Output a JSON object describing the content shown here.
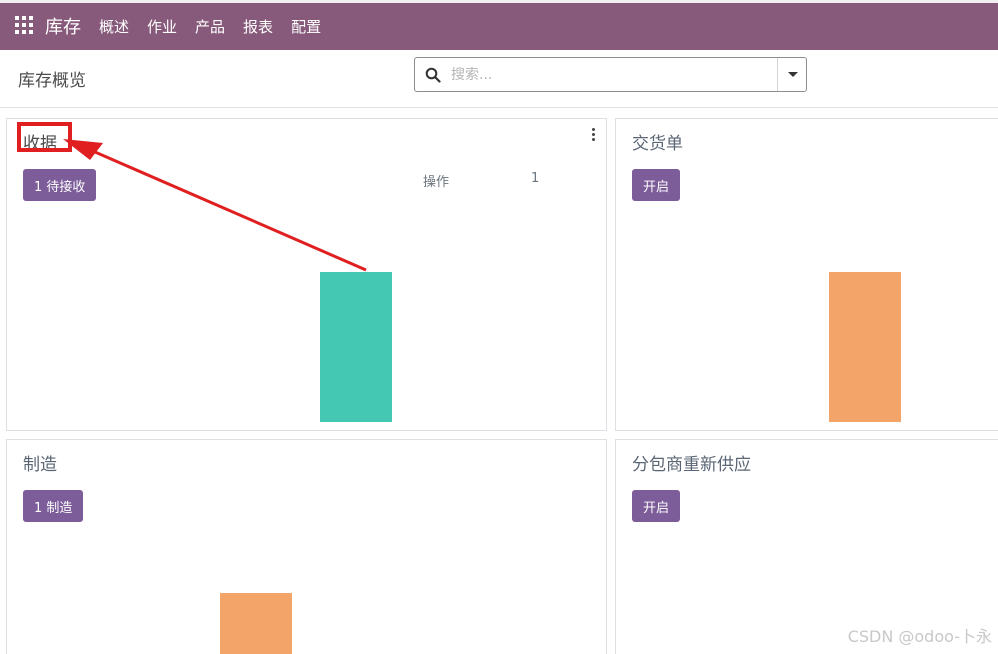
{
  "app": {
    "brand": "库存",
    "menu": [
      "概述",
      "作业",
      "产品",
      "报表",
      "配置"
    ]
  },
  "control": {
    "page_title": "库存概览",
    "search_placeholder": "搜索..."
  },
  "cards": [
    {
      "title": "收据",
      "button": "1 待接收",
      "stat_label": "操作",
      "stat_value": "1",
      "bar_color": "#44c8b3",
      "bar_value": 1
    },
    {
      "title": "交货单",
      "button": "开启",
      "bar_color": "#f3a468",
      "bar_value": 1
    },
    {
      "title": "制造",
      "button": "1 制造",
      "bar_color": "#f3a468",
      "bar_value": 1
    },
    {
      "title": "分包商重新供应",
      "button": "开启"
    }
  ],
  "colors": {
    "topbar": "#875a7b",
    "button": "#7c5c99",
    "annotation": "#e02020"
  },
  "watermark": "CSDN @odoo-卜永"
}
